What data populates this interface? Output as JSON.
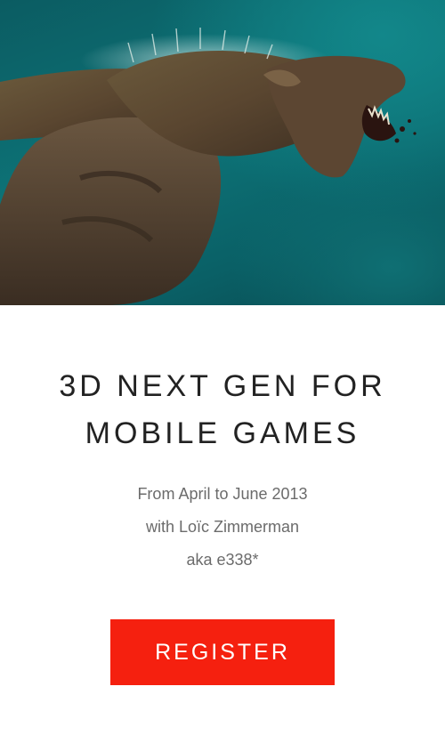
{
  "hero": {
    "image_subject": "werewolf-illustration"
  },
  "title": {
    "line1": "3D NEXT GEN FOR",
    "line2": "MOBILE GAMES"
  },
  "info": {
    "dates": "From April to June 2013",
    "instructor": "with Loïc Zimmerman",
    "alias": "aka e338*"
  },
  "cta": {
    "label": "REGISTER",
    "color": "#f5200f"
  },
  "colors": {
    "background": "#ffffff",
    "title": "#222222",
    "info_text": "#6b6b6b",
    "hero_teal": "#0d7377"
  }
}
